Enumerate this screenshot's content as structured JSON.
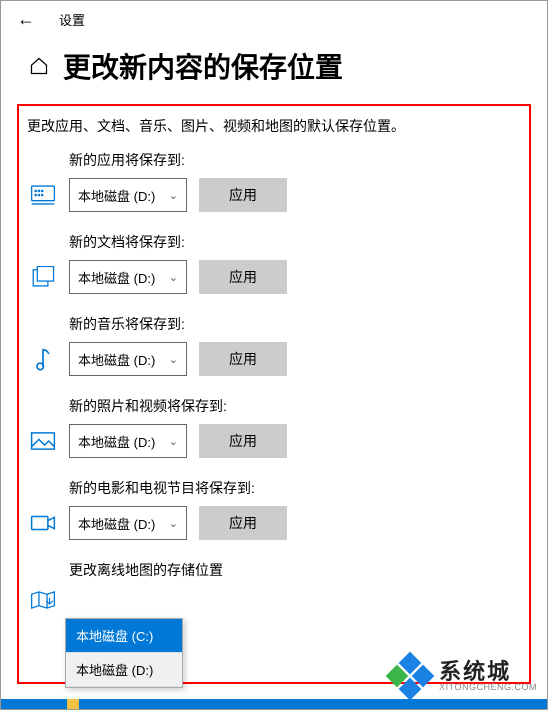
{
  "titlebar": {
    "label": "设置"
  },
  "page_title": "更改新内容的保存位置",
  "intro": "更改应用、文档、音乐、图片、视频和地图的默认保存位置。",
  "apply_label": "应用",
  "settings": [
    {
      "label": "新的应用将保存到:",
      "selected": "本地磁盘 (D:)",
      "icon": "apps"
    },
    {
      "label": "新的文档将保存到:",
      "selected": "本地磁盘 (D:)",
      "icon": "documents"
    },
    {
      "label": "新的音乐将保存到:",
      "selected": "本地磁盘 (D:)",
      "icon": "music"
    },
    {
      "label": "新的照片和视频将保存到:",
      "selected": "本地磁盘 (D:)",
      "icon": "photos"
    },
    {
      "label": "新的电影和电视节目将保存到:",
      "selected": "本地磁盘 (D:)",
      "icon": "movies"
    }
  ],
  "maps": {
    "label": "更改离线地图的存储位置",
    "options": [
      "本地磁盘 (C:)",
      "本地磁盘 (D:)"
    ],
    "selected": "本地磁盘 (C:)"
  },
  "watermark": {
    "big": "系统城",
    "small": "XITONGCHENG.COM"
  }
}
